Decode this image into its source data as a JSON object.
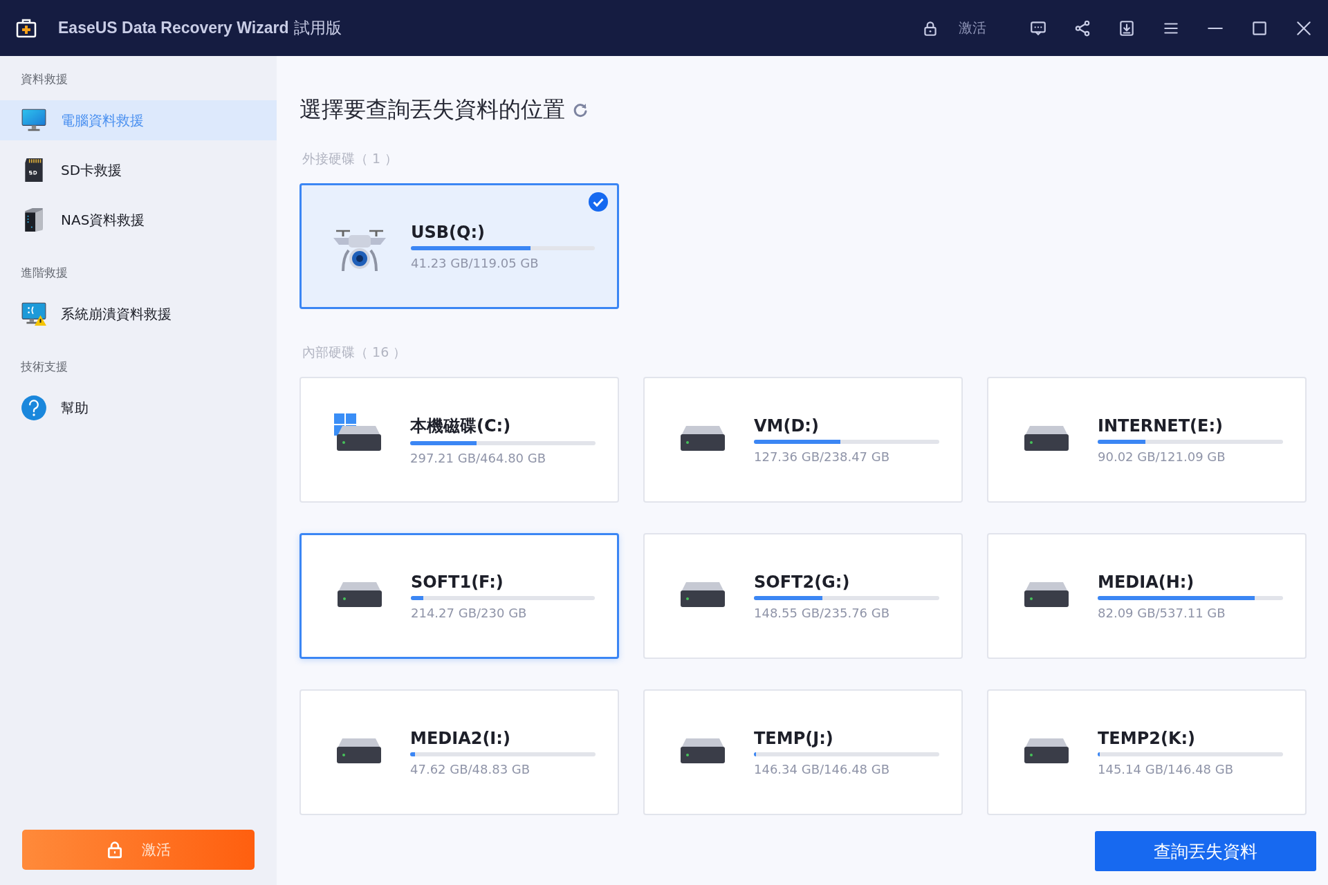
{
  "window": {
    "title": "EaseUS Data Recovery Wizard",
    "edition": "試用版",
    "activate_label": "激活"
  },
  "sidebar": {
    "sections": [
      {
        "label": "資料救援",
        "items": [
          {
            "label": "電腦資料救援",
            "kind": "monitor",
            "selected": true
          },
          {
            "label": "SD卡救援",
            "kind": "sd",
            "selected": false
          },
          {
            "label": "NAS資料救援",
            "kind": "nas",
            "selected": false
          }
        ]
      },
      {
        "label": "進階救援",
        "items": [
          {
            "label": "系統崩潰資料救援",
            "kind": "crash",
            "selected": false
          }
        ]
      },
      {
        "label": "技術支援",
        "items": [
          {
            "label": "幫助",
            "kind": "help",
            "selected": false
          }
        ]
      }
    ],
    "activate_button": "激活"
  },
  "main": {
    "heading": "選擇要查詢丟失資料的位置",
    "groups": [
      {
        "label": "外接硬碟（ 1 ）",
        "drives": [
          {
            "name": "USB(Q:)",
            "size": "41.23 GB/119.05 GB",
            "level": 0.65,
            "kind": "drone",
            "selected": true,
            "hovered": false
          }
        ]
      },
      {
        "label": "內部硬碟（ 16 ）",
        "drives": [
          {
            "name": "本機磁碟(C:)",
            "size": "297.21 GB/464.80 GB",
            "level": 0.36,
            "kind": "system",
            "selected": false,
            "hovered": false
          },
          {
            "name": "VM(D:)",
            "size": "127.36 GB/238.47 GB",
            "level": 0.466,
            "kind": "disk",
            "selected": false,
            "hovered": false
          },
          {
            "name": "INTERNET(E:)",
            "size": "90.02 GB/121.09 GB",
            "level": 0.257,
            "kind": "disk",
            "selected": false,
            "hovered": false
          },
          {
            "name": "SOFT1(F:)",
            "size": "214.27 GB/230 GB",
            "level": 0.068,
            "kind": "disk",
            "selected": false,
            "hovered": true
          },
          {
            "name": "SOFT2(G:)",
            "size": "148.55 GB/235.76 GB",
            "level": 0.37,
            "kind": "disk",
            "selected": false,
            "hovered": false
          },
          {
            "name": "MEDIA(H:)",
            "size": "82.09 GB/537.11 GB",
            "level": 0.847,
            "kind": "disk",
            "selected": false,
            "hovered": false
          },
          {
            "name": "MEDIA2(I:)",
            "size": "47.62 GB/48.83 GB",
            "level": 0.025,
            "kind": "disk",
            "selected": false,
            "hovered": false
          },
          {
            "name": "TEMP(J:)",
            "size": "146.34 GB/146.48 GB",
            "level": 0.001,
            "kind": "disk",
            "selected": false,
            "hovered": false
          },
          {
            "name": "TEMP2(K:)",
            "size": "145.14 GB/146.48 GB",
            "level": 0.009,
            "kind": "disk",
            "selected": false,
            "hovered": false
          }
        ]
      }
    ],
    "scan_button": "查詢丟失資料"
  }
}
